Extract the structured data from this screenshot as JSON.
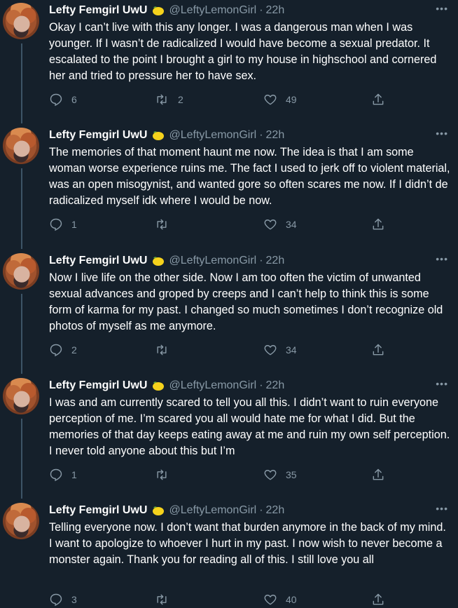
{
  "tweets": [
    {
      "name": "Lefty Femgirl UwU",
      "handle": "@LeftyLemonGirl",
      "time": "22h",
      "text": "Okay I can’t live with this any longer.  I was a dangerous man when I was younger.  If I wasn’t de radicalized I would have become a sexual predator.  It escalated to the point I brought a girl to my house in highschool and cornered her and tried to pressure her to have sex.",
      "replies": "6",
      "retweets": "2",
      "likes": "49"
    },
    {
      "name": "Lefty Femgirl UwU",
      "handle": "@LeftyLemonGirl",
      "time": "22h",
      "text": "The memories of that moment haunt me now.  The idea is that I am some woman worse experience ruins me.  The fact I used to jerk off to violent material, was an open misogynist, and wanted gore so often scares me now.  If I didn’t de radicalized myself idk where I would be now.",
      "replies": "1",
      "retweets": "",
      "likes": "34"
    },
    {
      "name": "Lefty Femgirl UwU",
      "handle": "@LeftyLemonGirl",
      "time": "22h",
      "text": "Now I live life on the other side.  Now I am too often the victim of unwanted sexual advances and groped by creeps and I can’t help to think this is some form of karma for my past.  I changed so much sometimes I don’t recognize old photos of myself as me anymore.",
      "replies": "2",
      "retweets": "",
      "likes": "34"
    },
    {
      "name": "Lefty Femgirl UwU",
      "handle": "@LeftyLemonGirl",
      "time": "22h",
      "text": "I was and am currently scared to tell you all this.  I didn’t want to ruin everyone perception of me.  I’m scared you all would hate me for what I did.  But the memories of that day keeps eating away at me and ruin my own self perception.  I never told anyone about this but I’m",
      "replies": "1",
      "retweets": "",
      "likes": "35"
    },
    {
      "name": "Lefty Femgirl UwU",
      "handle": "@LeftyLemonGirl",
      "time": "22h",
      "text": "Telling everyone now.  I don’t want that burden anymore in the back of my mind. I want to apologize to whoever I hurt in my past. I now wish to never become a monster again.  Thank you for reading all of this.  I still love you all",
      "replies": "3",
      "retweets": "",
      "likes": "40"
    }
  ],
  "icons": {
    "reply": "reply-icon",
    "retweet": "retweet-icon",
    "like": "heart-icon",
    "share": "share-icon",
    "more": "more-icon",
    "emoji": "lemon-icon"
  },
  "colors": {
    "background": "#15202b",
    "text": "#ffffff",
    "secondary": "#8899a6",
    "thread_line": "#3d5466"
  }
}
